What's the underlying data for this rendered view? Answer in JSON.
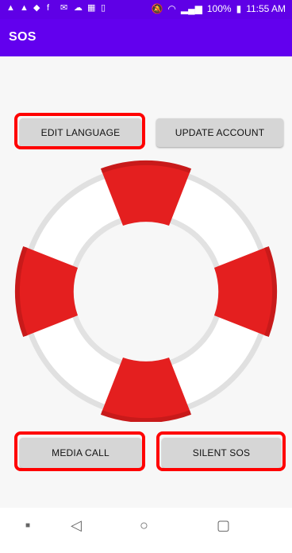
{
  "status_bar": {
    "left_icons": [
      "▲",
      "▲",
      "◆",
      "f",
      "✉",
      "☁",
      "▦",
      "▯"
    ],
    "battery": "100%",
    "time": "11:55 AM"
  },
  "app_bar": {
    "title": "SOS"
  },
  "buttons": {
    "edit_language": "EDIT LANGUAGE",
    "update_account": "UPDATE ACCOUNT",
    "media_call": "MEDIA CALL",
    "silent_sos": "SILENT SOS"
  },
  "colors": {
    "app_bar": "#6200ee",
    "status_bar": "#5f00e6",
    "highlight": "#ff0000",
    "ring_red": "#e41f1f",
    "ring_white": "#ffffff",
    "ring_gray": "#e2e2e2"
  },
  "icons": {
    "lifebuoy": "lifebuoy-icon",
    "nav_back": "back-triangle-icon",
    "nav_home": "home-circle-icon",
    "nav_recents": "recents-square-icon"
  }
}
